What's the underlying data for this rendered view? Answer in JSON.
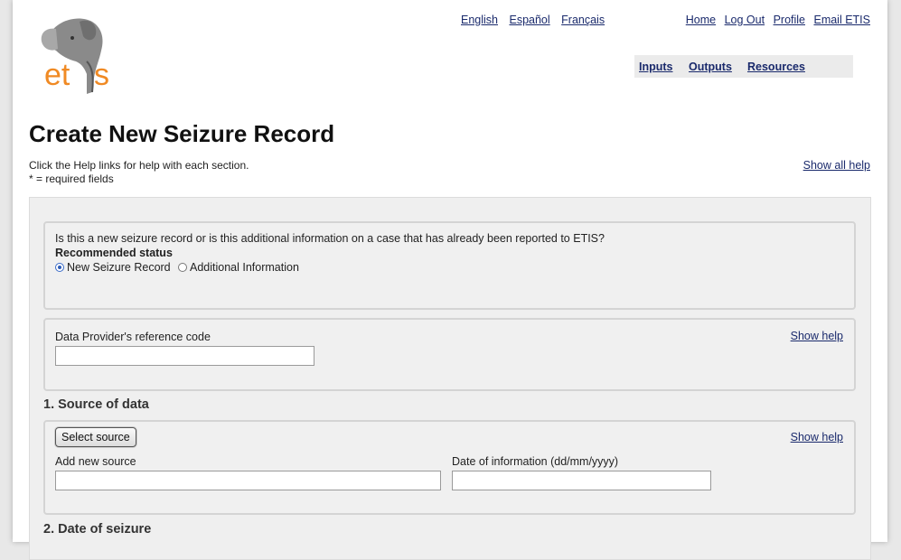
{
  "lang": [
    "English",
    "Español",
    "Français"
  ],
  "user_links": [
    "Home",
    "Log Out",
    "Profile",
    "Email ETIS"
  ],
  "logo": {
    "text": "etis"
  },
  "nav": [
    "Inputs",
    "Outputs",
    "Resources"
  ],
  "page_title": "Create New Seizure Record",
  "intro": {
    "line1": "Click the Help links for help with each section.",
    "line2": "* = required fields"
  },
  "show_all_help": "Show all help",
  "status": {
    "question": "Is this a new seizure record or is this additional information on a case that has already been reported to ETIS?",
    "label": "Recommended status",
    "opt_new": "New Seizure Record",
    "opt_additional": "Additional Information",
    "selected": "New Seizure Record"
  },
  "reference": {
    "label": "Data Provider's reference code",
    "value": "",
    "help": "Show help"
  },
  "source": {
    "heading": "1. Source of data",
    "select_button": "Select source",
    "add_label": "Add new source",
    "add_value": "",
    "date_label": "Date of information (dd/mm/yyyy)",
    "date_value": "",
    "help": "Show help"
  },
  "date_section": {
    "heading": "2. Date of seizure"
  },
  "colors": {
    "link": "#1a2a6c",
    "logo_orange": "#f08a24",
    "panel": "#efefef"
  }
}
